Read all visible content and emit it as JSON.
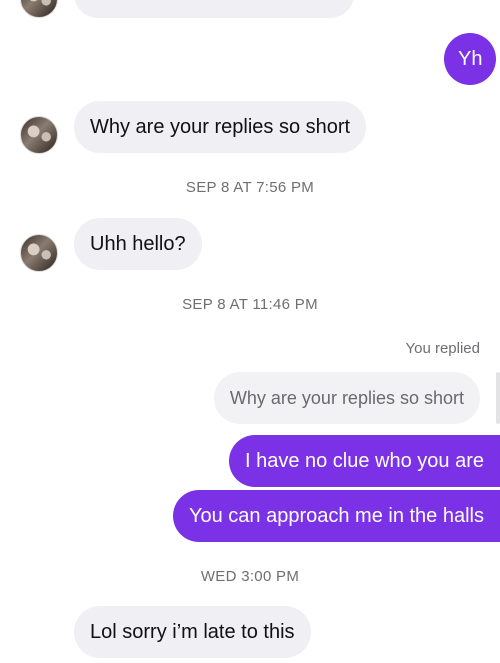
{
  "messages": {
    "top_partial": "",
    "yh": "Yh",
    "replies_short": "Why are your replies so short",
    "time1": "SEP 8 AT 7:56 PM",
    "uhh_hello": "Uhh hello?",
    "time2": "SEP 8 AT 11:46 PM",
    "you_replied": "You replied",
    "quoted": "Why are your replies so short",
    "no_clue": "I have no clue who you are",
    "approach": "You can approach me in the halls",
    "time3": "WED 3:00 PM",
    "lol_sorry": "Lol sorry i’m late to this"
  },
  "colors": {
    "outgoing": "#7b32e6",
    "incoming": "#efeff4"
  }
}
